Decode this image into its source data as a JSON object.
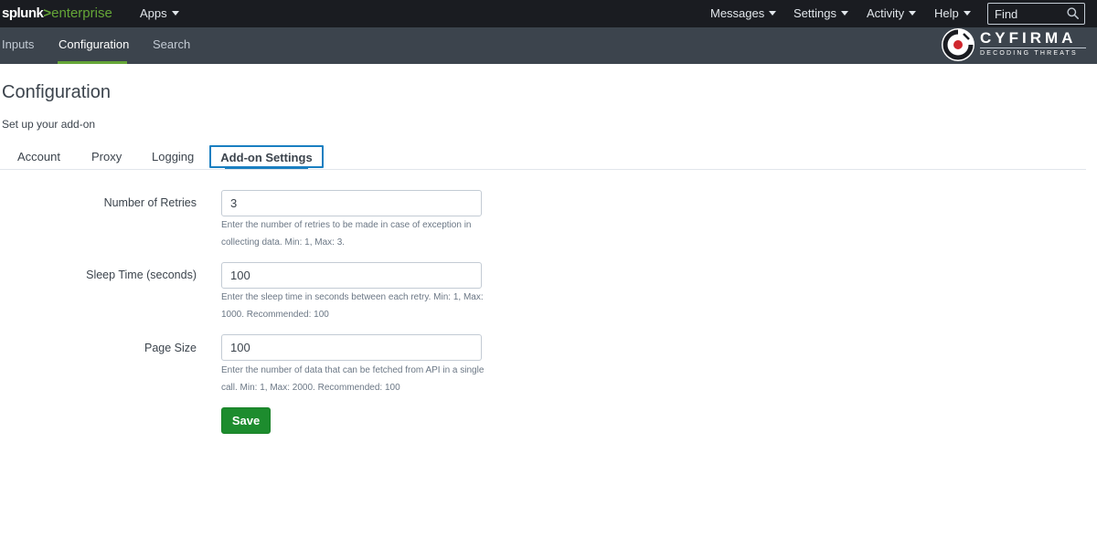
{
  "topbar": {
    "logo_main": "splunk",
    "logo_gt": ">",
    "logo_suffix": "enterprise",
    "apps_label": "Apps",
    "menus": [
      "Messages",
      "Settings",
      "Activity",
      "Help"
    ],
    "find_placeholder": "Find",
    "icons": {
      "search": "search-icon",
      "caret": "caret-down-icon"
    }
  },
  "appbar": {
    "tabs": [
      "Inputs",
      "Configuration",
      "Search"
    ],
    "active_tab": "Configuration",
    "brand_name": "CYFIRMA",
    "brand_tagline": "DECODING THREATS"
  },
  "page": {
    "title": "Configuration",
    "subtitle": "Set up your add-on",
    "tabs": [
      "Account",
      "Proxy",
      "Logging",
      "Add-on Settings"
    ],
    "active_tab": "Add-on Settings"
  },
  "form": {
    "fields": [
      {
        "label": "Number of Retries",
        "value": "3",
        "help": "Enter the number of retries to be made in case of exception in collecting data. Min: 1, Max: 3."
      },
      {
        "label": "Sleep Time (seconds)",
        "value": "100",
        "help": "Enter the sleep time in seconds between each retry. Min: 1, Max: 1000. Recommended: 100"
      },
      {
        "label": "Page Size",
        "value": "100",
        "help": "Enter the number of data that can be fetched from API in a single call. Min: 1, Max: 2000. Recommended: 100"
      }
    ],
    "save_label": "Save"
  },
  "colors": {
    "topbar": "#1a1c21",
    "appbar": "#3c444d",
    "accent_green": "#65a637",
    "active_tab_blue": "#1a7fc1",
    "save_button": "#1d8c2e"
  }
}
